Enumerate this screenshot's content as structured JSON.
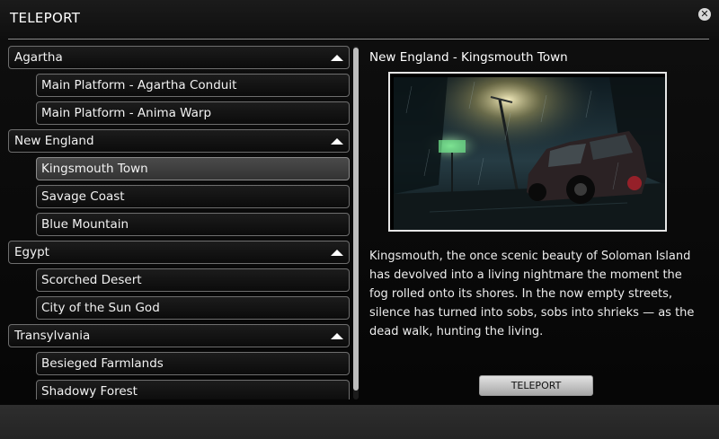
{
  "window": {
    "title": "TELEPORT",
    "close_icon": "close-icon"
  },
  "list": {
    "categories": [
      {
        "label": "Agartha",
        "expanded": true,
        "locations": [
          "Main Platform - Agartha Conduit",
          "Main Platform - Anima Warp"
        ]
      },
      {
        "label": "New England",
        "expanded": true,
        "locations": [
          "Kingsmouth Town",
          "Savage Coast",
          "Blue Mountain"
        ]
      },
      {
        "label": "Egypt",
        "expanded": true,
        "locations": [
          "Scorched Desert",
          "City of the Sun God"
        ]
      },
      {
        "label": "Transylvania",
        "expanded": true,
        "locations": [
          "Besieged Farmlands",
          "Shadowy Forest"
        ]
      }
    ],
    "selected": "Kingsmouth Town"
  },
  "detail": {
    "title": "New England - Kingsmouth Town",
    "description": "Kingsmouth, the once scenic beauty of Soloman Island has devolved into a living nightmare the moment the fog rolled onto its shores. In the now empty streets, silence has turned into sobs, sobs into shrieks — as the dead walk, hunting the living."
  },
  "actions": {
    "teleport_label": "TELEPORT"
  },
  "colors": {
    "background": "#0a0a0a",
    "row_border": "#6e6e6e",
    "selected_row": "#4a4a4a",
    "button": "#d0d0d0"
  }
}
